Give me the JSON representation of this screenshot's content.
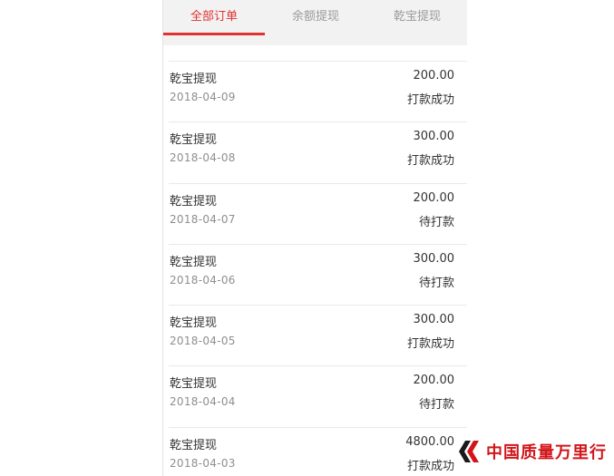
{
  "tabs": [
    {
      "label": "全部订单",
      "active": true
    },
    {
      "label": "余额提现",
      "active": false
    },
    {
      "label": "乾宝提现",
      "active": false
    }
  ],
  "orders": [
    {
      "title": "乾宝提现",
      "date": "2018-04-09",
      "amount": "200.00",
      "status": "打款成功"
    },
    {
      "title": "乾宝提现",
      "date": "2018-04-08",
      "amount": "300.00",
      "status": "打款成功"
    },
    {
      "title": "乾宝提现",
      "date": "2018-04-07",
      "amount": "200.00",
      "status": "待打款"
    },
    {
      "title": "乾宝提现",
      "date": "2018-04-06",
      "amount": "300.00",
      "status": "待打款"
    },
    {
      "title": "乾宝提现",
      "date": "2018-04-05",
      "amount": "300.00",
      "status": "打款成功"
    },
    {
      "title": "乾宝提现",
      "date": "2018-04-04",
      "amount": "200.00",
      "status": "待打款"
    },
    {
      "title": "乾宝提现",
      "date": "2018-04-03",
      "amount": "4800.00",
      "status": "打款成功"
    }
  ],
  "watermark": {
    "text": "中国质量万里行",
    "icon": "double-chevron-logo-icon"
  },
  "colors": {
    "accent": "#e0322f",
    "tab_bg": "#f2f2f2",
    "watermark": "#d2151a"
  }
}
